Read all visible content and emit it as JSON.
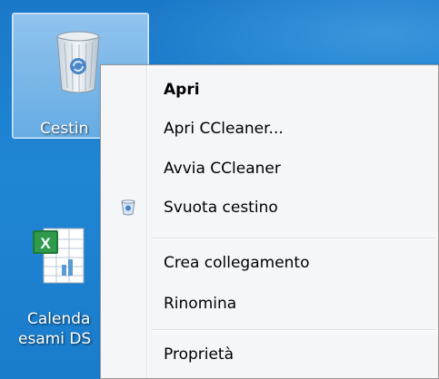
{
  "desktop": {
    "icons": [
      {
        "label": "Cestin",
        "icon": "recycle-bin-icon"
      },
      {
        "label_line1": "Calenda",
        "label_line2": "esami DS",
        "icon": "excel-file-icon"
      }
    ]
  },
  "context_menu": {
    "items": [
      {
        "label": "Apri",
        "bold": true
      },
      {
        "label": "Apri CCleaner..."
      },
      {
        "label": "Avvia CCleaner"
      },
      {
        "label": "Svuota cestino",
        "icon": "empty-bin-icon"
      },
      {
        "label": "Crea collegamento"
      },
      {
        "label": "Rinomina"
      },
      {
        "label": "Proprietà"
      }
    ]
  },
  "colors": {
    "desktop_blue": "#1b78c8",
    "menu_background": "#f5f6f8",
    "menu_border": "#979797"
  }
}
